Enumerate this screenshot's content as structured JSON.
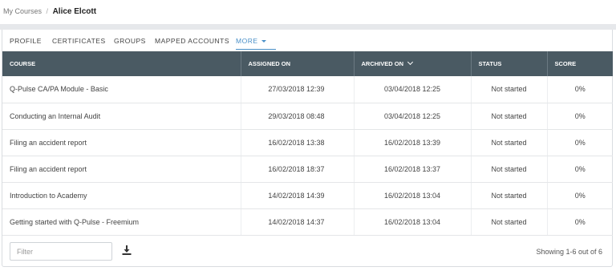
{
  "breadcrumb": {
    "parent": "My Courses",
    "separator": "/",
    "current": "Alice Elcott"
  },
  "tabs": [
    {
      "label": "PROFILE"
    },
    {
      "label": "CERTIFICATES"
    },
    {
      "label": "GROUPS"
    },
    {
      "label": "MAPPED ACCOUNTS"
    },
    {
      "label": "MORE",
      "active": true
    }
  ],
  "table": {
    "headers": {
      "course": "COURSE",
      "assigned": "ASSIGNED ON",
      "archived": "ARCHIVED ON",
      "status": "STATUS",
      "score": "SCORE"
    },
    "rows": [
      {
        "course": "Q-Pulse CA/PA Module - Basic",
        "assigned": "27/03/2018 12:39",
        "archived": "03/04/2018 12:25",
        "status": "Not started",
        "score": "0%"
      },
      {
        "course": "Conducting an Internal Audit",
        "assigned": "29/03/2018 08:48",
        "archived": "03/04/2018 12:25",
        "status": "Not started",
        "score": "0%"
      },
      {
        "course": "Filing an accident report",
        "assigned": "16/02/2018 13:38",
        "archived": "16/02/2018 13:39",
        "status": "Not started",
        "score": "0%"
      },
      {
        "course": "Filing an accident report",
        "assigned": "16/02/2018 18:37",
        "archived": "16/02/2018 13:37",
        "status": "Not started",
        "score": "0%"
      },
      {
        "course": "Introduction to Academy",
        "assigned": "14/02/2018 14:39",
        "archived": "16/02/2018 13:04",
        "status": "Not started",
        "score": "0%"
      },
      {
        "course": "Getting started with Q-Pulse - Freemium",
        "assigned": "14/02/2018 14:37",
        "archived": "16/02/2018 13:04",
        "status": "Not started",
        "score": "0%"
      }
    ]
  },
  "footer": {
    "filter_placeholder": "Filter",
    "download_icon": "download-icon",
    "showing": "Showing 1-6 out of 6"
  },
  "colors": {
    "header_bg": "#4a5a63",
    "accent": "#4a90c8"
  }
}
